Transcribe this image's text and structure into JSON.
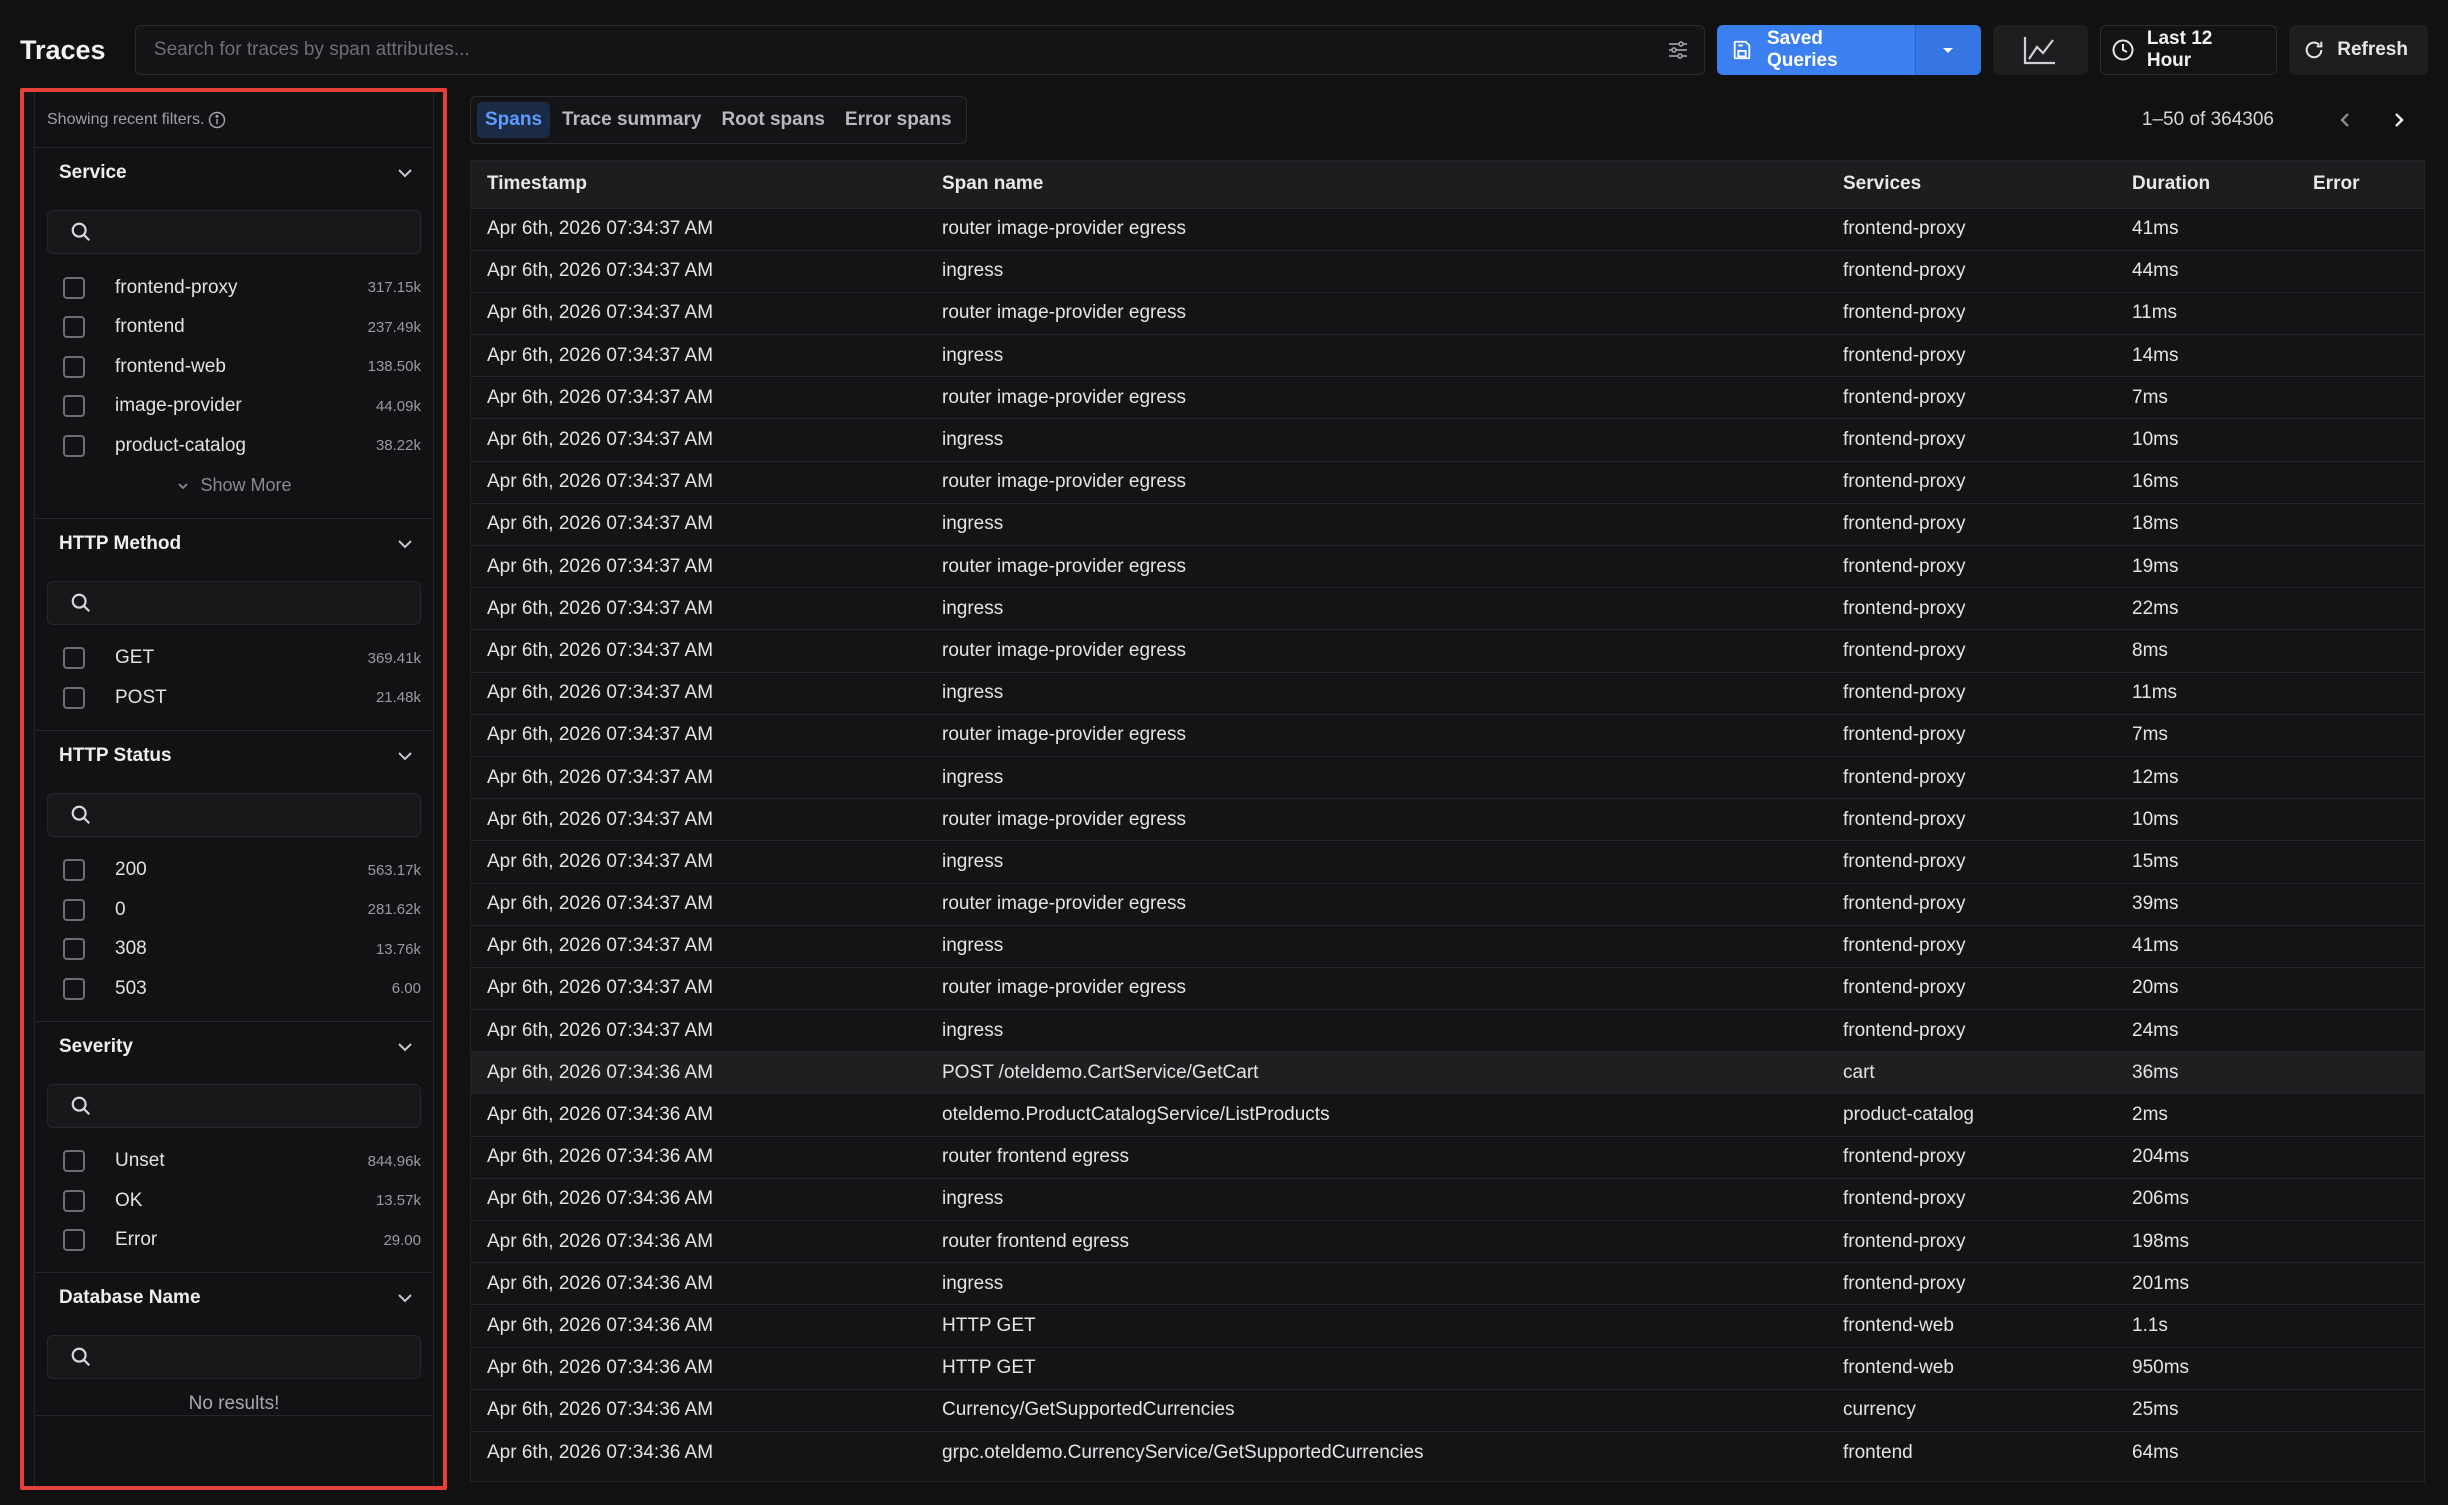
{
  "header": {
    "title": "Traces",
    "search_placeholder": "Search for traces by span attributes...",
    "saved_queries_label": "Saved Queries",
    "time_range_label": "Last 12 Hour",
    "refresh_label": "Refresh"
  },
  "colors": {
    "accent": "#3b7ff0",
    "highlight_border": "#e5403a",
    "background": "#111112"
  },
  "sidebar": {
    "recent_filters_label": "Showing recent filters.",
    "groups": [
      {
        "title": "Service",
        "items": [
          {
            "label": "frontend-proxy",
            "count": "317.15k"
          },
          {
            "label": "frontend",
            "count": "237.49k"
          },
          {
            "label": "frontend-web",
            "count": "138.50k"
          },
          {
            "label": "image-provider",
            "count": "44.09k"
          },
          {
            "label": "product-catalog",
            "count": "38.22k"
          }
        ],
        "show_more_label": "Show More"
      },
      {
        "title": "HTTP Method",
        "items": [
          {
            "label": "GET",
            "count": "369.41k"
          },
          {
            "label": "POST",
            "count": "21.48k"
          }
        ]
      },
      {
        "title": "HTTP Status",
        "items": [
          {
            "label": "200",
            "count": "563.17k"
          },
          {
            "label": "0",
            "count": "281.62k"
          },
          {
            "label": "308",
            "count": "13.76k"
          },
          {
            "label": "503",
            "count": "6.00"
          }
        ]
      },
      {
        "title": "Severity",
        "items": [
          {
            "label": "Unset",
            "count": "844.96k"
          },
          {
            "label": "OK",
            "count": "13.57k"
          },
          {
            "label": "Error",
            "count": "29.00"
          }
        ]
      },
      {
        "title": "Database Name",
        "items": [],
        "empty_label": "No results!"
      }
    ]
  },
  "tabs": [
    {
      "label": "Spans",
      "active": true
    },
    {
      "label": "Trace summary",
      "active": false
    },
    {
      "label": "Root spans",
      "active": false
    },
    {
      "label": "Error spans",
      "active": false
    }
  ],
  "pagination": {
    "range_label": "1–50 of 364306"
  },
  "table": {
    "columns": [
      "Timestamp",
      "Span name",
      "Services",
      "Duration",
      "Error"
    ],
    "rows": [
      [
        "Apr 6th, 2026 07:34:37 AM",
        "router image-provider egress",
        "frontend-proxy",
        "41ms",
        ""
      ],
      [
        "Apr 6th, 2026 07:34:37 AM",
        "ingress",
        "frontend-proxy",
        "44ms",
        ""
      ],
      [
        "Apr 6th, 2026 07:34:37 AM",
        "router image-provider egress",
        "frontend-proxy",
        "11ms",
        ""
      ],
      [
        "Apr 6th, 2026 07:34:37 AM",
        "ingress",
        "frontend-proxy",
        "14ms",
        ""
      ],
      [
        "Apr 6th, 2026 07:34:37 AM",
        "router image-provider egress",
        "frontend-proxy",
        "7ms",
        ""
      ],
      [
        "Apr 6th, 2026 07:34:37 AM",
        "ingress",
        "frontend-proxy",
        "10ms",
        ""
      ],
      [
        "Apr 6th, 2026 07:34:37 AM",
        "router image-provider egress",
        "frontend-proxy",
        "16ms",
        ""
      ],
      [
        "Apr 6th, 2026 07:34:37 AM",
        "ingress",
        "frontend-proxy",
        "18ms",
        ""
      ],
      [
        "Apr 6th, 2026 07:34:37 AM",
        "router image-provider egress",
        "frontend-proxy",
        "19ms",
        ""
      ],
      [
        "Apr 6th, 2026 07:34:37 AM",
        "ingress",
        "frontend-proxy",
        "22ms",
        ""
      ],
      [
        "Apr 6th, 2026 07:34:37 AM",
        "router image-provider egress",
        "frontend-proxy",
        "8ms",
        ""
      ],
      [
        "Apr 6th, 2026 07:34:37 AM",
        "ingress",
        "frontend-proxy",
        "11ms",
        ""
      ],
      [
        "Apr 6th, 2026 07:34:37 AM",
        "router image-provider egress",
        "frontend-proxy",
        "7ms",
        ""
      ],
      [
        "Apr 6th, 2026 07:34:37 AM",
        "ingress",
        "frontend-proxy",
        "12ms",
        ""
      ],
      [
        "Apr 6th, 2026 07:34:37 AM",
        "router image-provider egress",
        "frontend-proxy",
        "10ms",
        ""
      ],
      [
        "Apr 6th, 2026 07:34:37 AM",
        "ingress",
        "frontend-proxy",
        "15ms",
        ""
      ],
      [
        "Apr 6th, 2026 07:34:37 AM",
        "router image-provider egress",
        "frontend-proxy",
        "39ms",
        ""
      ],
      [
        "Apr 6th, 2026 07:34:37 AM",
        "ingress",
        "frontend-proxy",
        "41ms",
        ""
      ],
      [
        "Apr 6th, 2026 07:34:37 AM",
        "router image-provider egress",
        "frontend-proxy",
        "20ms",
        ""
      ],
      [
        "Apr 6th, 2026 07:34:37 AM",
        "ingress",
        "frontend-proxy",
        "24ms",
        ""
      ],
      [
        "Apr 6th, 2026 07:34:36 AM",
        "POST /oteldemo.CartService/GetCart",
        "cart",
        "36ms",
        ""
      ],
      [
        "Apr 6th, 2026 07:34:36 AM",
        "oteldemo.ProductCatalogService/ListProducts",
        "product-catalog",
        "2ms",
        ""
      ],
      [
        "Apr 6th, 2026 07:34:36 AM",
        "router frontend egress",
        "frontend-proxy",
        "204ms",
        ""
      ],
      [
        "Apr 6th, 2026 07:34:36 AM",
        "ingress",
        "frontend-proxy",
        "206ms",
        ""
      ],
      [
        "Apr 6th, 2026 07:34:36 AM",
        "router frontend egress",
        "frontend-proxy",
        "198ms",
        ""
      ],
      [
        "Apr 6th, 2026 07:34:36 AM",
        "ingress",
        "frontend-proxy",
        "201ms",
        ""
      ],
      [
        "Apr 6th, 2026 07:34:36 AM",
        "HTTP GET",
        "frontend-web",
        "1.1s",
        ""
      ],
      [
        "Apr 6th, 2026 07:34:36 AM",
        "HTTP GET",
        "frontend-web",
        "950ms",
        ""
      ],
      [
        "Apr 6th, 2026 07:34:36 AM",
        "Currency/GetSupportedCurrencies",
        "currency",
        "25ms",
        ""
      ],
      [
        "Apr 6th, 2026 07:34:36 AM",
        "grpc.oteldemo.CurrencyService/GetSupportedCurrencies",
        "frontend",
        "64ms",
        ""
      ]
    ],
    "highlighted_row": 20
  }
}
